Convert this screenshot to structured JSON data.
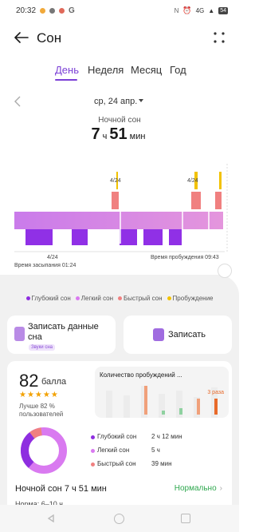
{
  "status_bar": {
    "time": "20:32",
    "network": "4G",
    "battery": "54"
  },
  "header": {
    "title": "Сон"
  },
  "tabs": [
    "День",
    "Неделя",
    "Месяц",
    "Год"
  ],
  "active_tab": "День",
  "date": {
    "label": "ср, 24 апр."
  },
  "summary": {
    "subtitle": "Ночной сон",
    "hours": "7",
    "hours_unit": "ч",
    "minutes": "51",
    "minutes_unit": "мин"
  },
  "hypnogram": {
    "top_date_left": "4/24",
    "top_date_right": "4/24",
    "bottom_date": "4/24",
    "fall_asleep": "Время засыпания 01:24",
    "wake_up": "Время пробуждения 09:43"
  },
  "legend": [
    {
      "label": "Глубокий сон",
      "color": "#8e2ee0"
    },
    {
      "label": "Легкий сон",
      "color": "#d97af0"
    },
    {
      "label": "Быстрый сон",
      "color": "#f08080"
    },
    {
      "label": "Пробуждение",
      "color": "#f2c200"
    }
  ],
  "actions": {
    "record_data_line1": "Записать данные",
    "record_data_line2": "сна",
    "record_data_badge": "Звуки сна",
    "record": "Записать"
  },
  "score": {
    "value": "82",
    "unit": "балла",
    "stars": "★★★★★",
    "better_line1": "Лучше 82 %",
    "better_line2": "пользователей"
  },
  "wakeups": {
    "title": "Количество пробуждений ...",
    "count": "3 раза"
  },
  "breakdown": [
    {
      "name": "Глубокий сон",
      "value": "2 ч 12 мин",
      "color": "#8e2ee0"
    },
    {
      "name": "Легкий сон",
      "value": "5 ч",
      "color": "#d97af0"
    },
    {
      "name": "Быстрый сон",
      "value": "39 мин",
      "color": "#f08080"
    }
  ],
  "night": {
    "title": "Ночной сон  7 ч 51 мин",
    "status": "Нормально",
    "norm": "Норма: 6–10 ч"
  },
  "icons": {
    "back": "arrow-left-icon",
    "more": "grid-dots-icon",
    "prev": "chevron-left-icon"
  }
}
